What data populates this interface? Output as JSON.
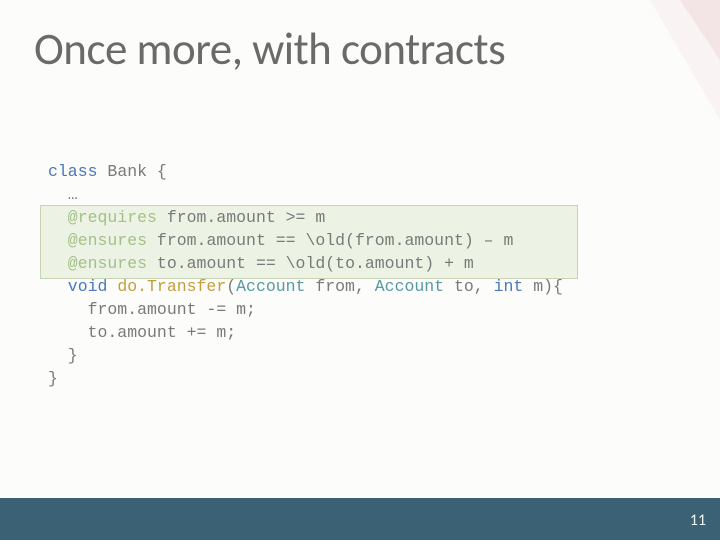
{
  "slide": {
    "title": "Once more, with contracts",
    "code": {
      "l1a": "class",
      "l1b": " Bank {",
      "l2": "  …",
      "l3a": "  @requires",
      "l3b": " from.amount >= m",
      "l4a": "  @ensures",
      "l4b": " from.amount == \\old(from.amount) – m",
      "l5a": "  @ensures",
      "l5b": " to.amount == \\old(to.amount) + m",
      "l6a": "  void ",
      "l6b": "do.Transfer",
      "l6c": "(",
      "l6d": "Account",
      "l6e": " from, ",
      "l6f": "Account",
      "l6g": " to, ",
      "l6h": "int",
      "l6i": " m){",
      "l7": "    from.amount -= m;",
      "l8": "    to.amount += m;",
      "l9": "  }",
      "l10": "}"
    },
    "page_number": "11"
  }
}
